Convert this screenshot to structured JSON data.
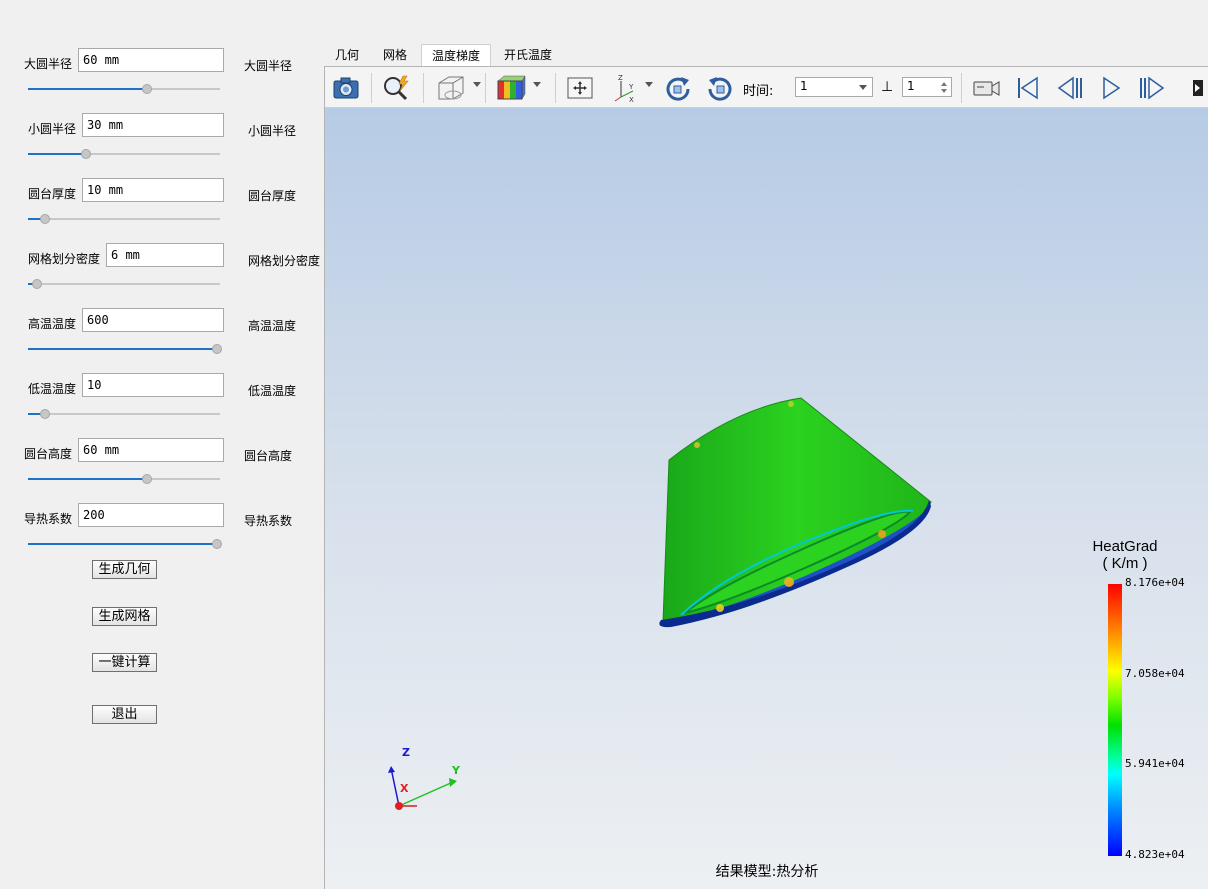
{
  "params": [
    {
      "label": "大圆半径",
      "value": "60 mm",
      "right_label": "大圆半径",
      "slider_pct": 0.62
    },
    {
      "label": "小圆半径",
      "value": "30 mm",
      "right_label": "小圆半径",
      "slider_pct": 0.3
    },
    {
      "label": "圆台厚度",
      "value": "10 mm",
      "right_label": "圆台厚度",
      "slider_pct": 0.08
    },
    {
      "label": "网格划分密度",
      "value": "6 mm",
      "right_label": "网格划分密度",
      "slider_pct": 0.04
    },
    {
      "label": "高温温度",
      "value": "600",
      "right_label": "高温温度",
      "slider_pct": 1.0
    },
    {
      "label": "低温温度",
      "value": "10",
      "right_label": "低温温度",
      "slider_pct": 0.08
    },
    {
      "label": "圆台高度",
      "value": "60 mm",
      "right_label": "圆台高度",
      "slider_pct": 0.62
    },
    {
      "label": "导热系数",
      "value": "200",
      "right_label": "导热系数",
      "slider_pct": 1.0
    }
  ],
  "buttons": {
    "generate_geometry": "生成几何",
    "generate_mesh": "生成网格",
    "one_click_compute": "一键计算",
    "exit": "退出"
  },
  "tabs": [
    "几何",
    "网格",
    "温度梯度",
    "开氏温度"
  ],
  "active_tab": "温度梯度",
  "toolbar": {
    "time_label": "时间:",
    "time_value": "1",
    "step_symbol": "⊥",
    "step_value": "1",
    "icons": [
      "camera-icon",
      "zoom-icon",
      "display-mode-icon",
      "color-map-icon",
      "fit-view-icon",
      "axes-view-icon",
      "rotate-cw-icon",
      "rotate-ccw-icon",
      "record-icon",
      "first-frame-icon",
      "previous-frame-icon",
      "play-icon",
      "next-frame-icon"
    ]
  },
  "legend": {
    "title": "HeatGrad",
    "unit": "( K/m )",
    "max": "8.176e+04",
    "mid_high": "7.058e+04",
    "mid_low": "5.941e+04",
    "min": "4.823e+04"
  },
  "axes": {
    "z": "Z",
    "y": "Y",
    "x": "X"
  },
  "status": "结果模型:热分析",
  "colors": {
    "accent": "#1e73c8",
    "legend_max": "#ff0000",
    "legend_min": "#0000ff",
    "body": "#22c41c"
  }
}
